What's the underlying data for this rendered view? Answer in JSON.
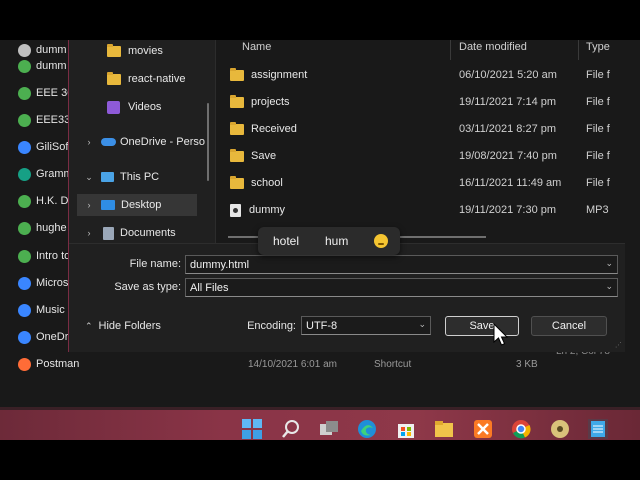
{
  "background_list": {
    "items": [
      {
        "label": "dumm",
        "color": "#bfbfbf"
      },
      {
        "label": "dumm",
        "color": "#4caf50"
      },
      {
        "label": "EEE 36",
        "color": "#4caf50"
      },
      {
        "label": "EEE332",
        "color": "#4caf50"
      },
      {
        "label": "GiliSof",
        "color": "#3a86ff"
      },
      {
        "label": "Gramm",
        "color": "#16a085"
      },
      {
        "label": "H.K. Da",
        "color": "#4caf50"
      },
      {
        "label": "hughe",
        "color": "#4caf50"
      },
      {
        "label": "Intro to",
        "color": "#4caf50"
      },
      {
        "label": "Micros",
        "color": "#3a86ff"
      },
      {
        "label": "Music",
        "color": "#3a86ff"
      },
      {
        "label": "OneDr",
        "color": "#3a86ff"
      },
      {
        "label": "Postman",
        "color": "#ff6c37"
      }
    ],
    "postman_row": {
      "date": "14/10/2021 6:01 am",
      "type": "Shortcut",
      "size": "3 KB"
    },
    "status_text": "Ln 2, Col 78"
  },
  "nav": {
    "items": [
      {
        "label": "movies",
        "kind": "folder"
      },
      {
        "label": "react-native",
        "kind": "folder"
      },
      {
        "label": "Videos",
        "kind": "videos"
      },
      {
        "label": "OneDrive - Perso",
        "kind": "onedrive",
        "chevron": "›"
      },
      {
        "label": "This PC",
        "kind": "pc",
        "chevron": "⌄"
      },
      {
        "label": "Desktop",
        "kind": "desktop",
        "chevron": "›"
      },
      {
        "label": "Documents",
        "kind": "documents",
        "chevron": "›"
      }
    ]
  },
  "columns": {
    "name": "Name",
    "date": "Date modified",
    "type": "Type"
  },
  "files": [
    {
      "name": "assignment",
      "date": "06/10/2021 5:20 am",
      "type": "File f",
      "kind": "folder"
    },
    {
      "name": "projects",
      "date": "19/11/2021 7:14 pm",
      "type": "File f",
      "kind": "folder"
    },
    {
      "name": "Received",
      "date": "03/11/2021 8:27 pm",
      "type": "File f",
      "kind": "folder"
    },
    {
      "name": "Save",
      "date": "19/08/2021 7:40 pm",
      "type": "File f",
      "kind": "folder"
    },
    {
      "name": "school",
      "date": "16/11/2021 11:49 am",
      "type": "File f",
      "kind": "folder"
    },
    {
      "name": "dummy",
      "date": "19/11/2021 7:30 pm",
      "type": "MP3",
      "kind": "audio"
    }
  ],
  "suggestions": {
    "word1": "hotel",
    "word2": "hum",
    "emoji": "thinking-face"
  },
  "form": {
    "file_name_label": "File name:",
    "file_name_value": "dummy.html",
    "save_type_label": "Save as type:",
    "save_type_value": "All Files",
    "hide_folders_label": "Hide Folders",
    "encoding_label": "Encoding:",
    "encoding_value": "UTF-8",
    "save_label": "Save",
    "cancel_label": "Cancel"
  },
  "taskbar": {
    "icons": [
      "windows-start-icon",
      "search-icon",
      "task-view-icon",
      "edge-icon",
      "store-icon",
      "file-explorer-icon",
      "xampp-icon",
      "chrome-icon",
      "media-icon",
      "notepad-icon"
    ]
  },
  "colors": {
    "accent": "#7a2c44",
    "taskbar": "#8a3447",
    "folder": "#e8b83c"
  }
}
